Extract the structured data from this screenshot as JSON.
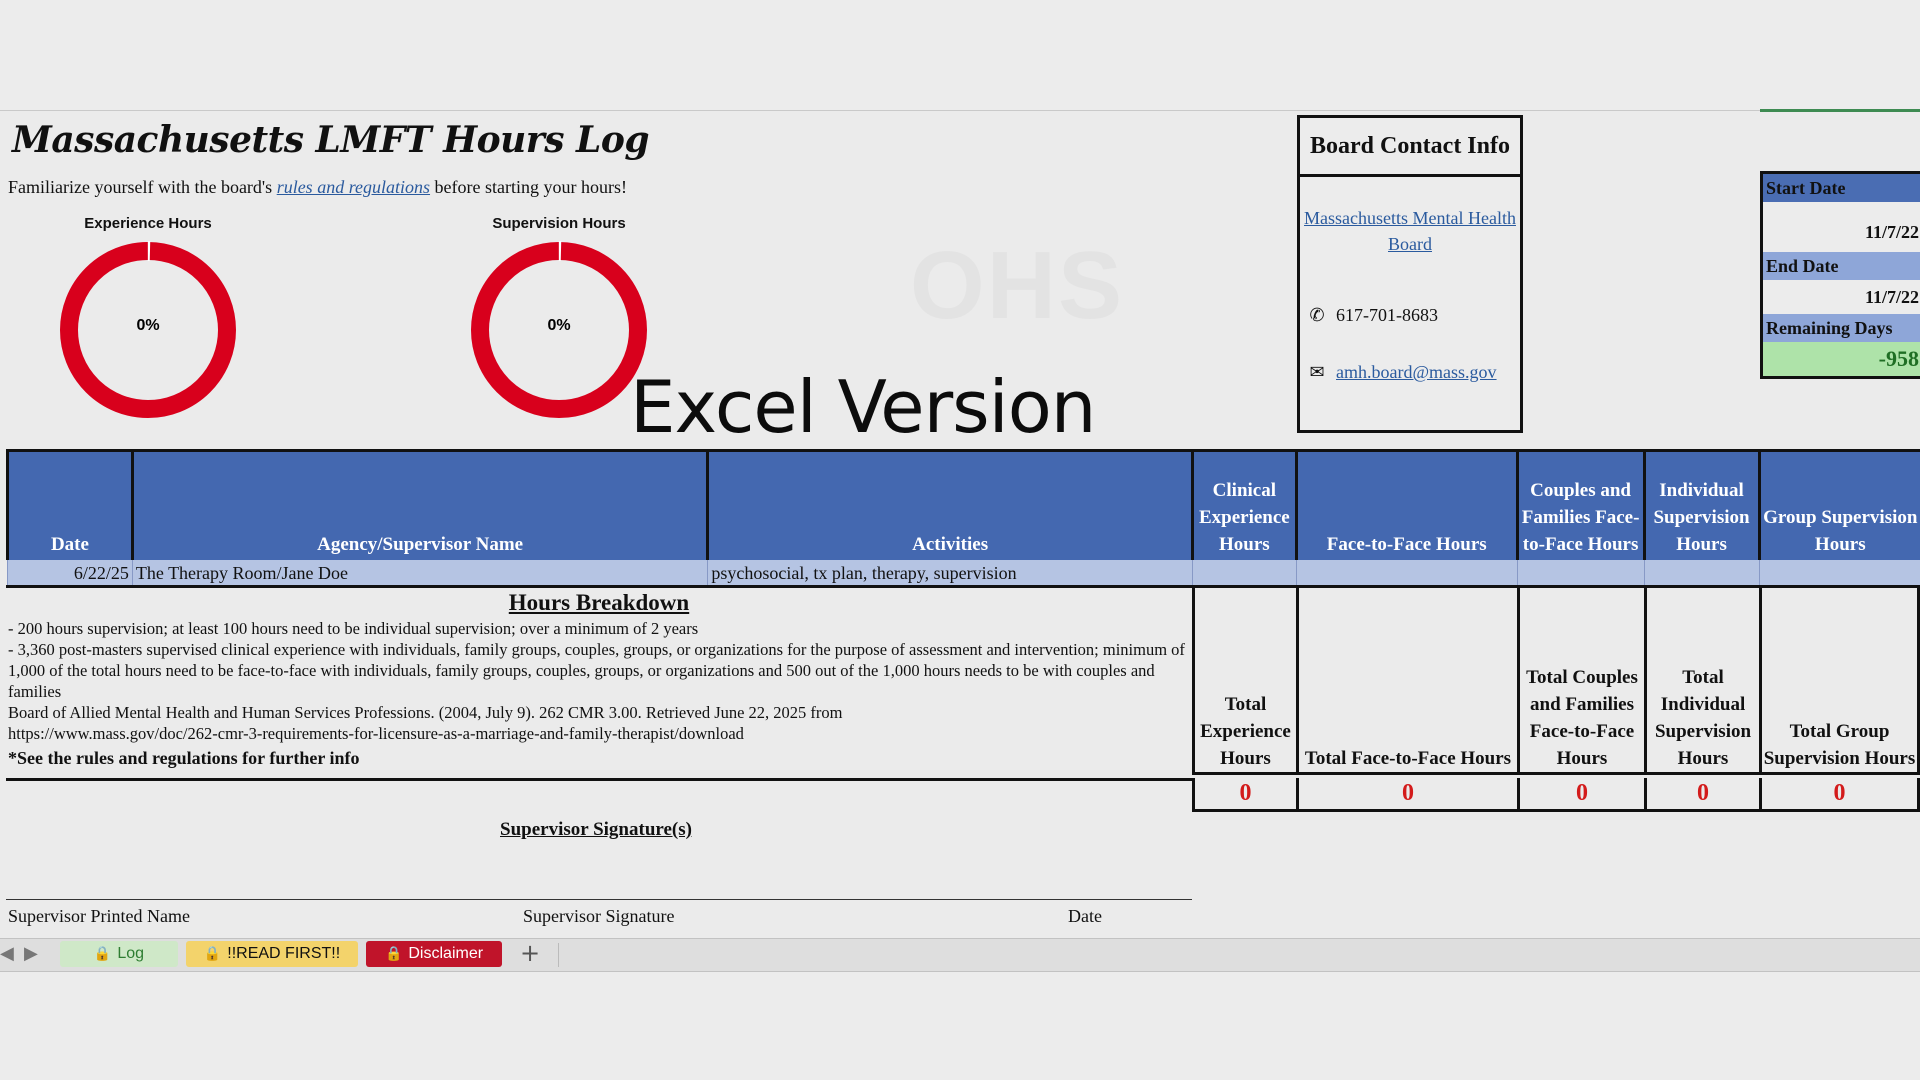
{
  "title": "Massachusetts LMFT Hours Log",
  "intro": {
    "before": "Familiarize yourself with the board's ",
    "link": "rules and regulations",
    "after": " before starting your hours!"
  },
  "gauges": [
    {
      "title": "Experience Hours",
      "percent_label": "0%",
      "value": 0
    },
    {
      "title": "Supervision Hours",
      "percent_label": "0%",
      "value": 0
    }
  ],
  "overlay_text": "Excel Version",
  "watermark": "OHS",
  "contact": {
    "heading": "Board Contact Info",
    "board_link": "Massachusetts Mental Health Board",
    "phone": "617-701-8683",
    "email": "amh.board@mass.gov"
  },
  "dates": {
    "start_label": "Start Date",
    "start_value": "11/7/22",
    "end_label": "End Date",
    "end_value": "11/7/22",
    "remaining_label": "Remaining Days",
    "remaining_value": "-958"
  },
  "table": {
    "headers": [
      "Date",
      "Agency/Supervisor Name",
      "Activities",
      "Clinical Experience Hours",
      "Face-to-Face Hours",
      "Couples and Families Face-to-Face Hours",
      "Individual Supervision Hours",
      "Group Supervision Hours"
    ],
    "rows": [
      [
        "6/22/25",
        "The Therapy Room/Jane Doe",
        "psychosocial, tx plan, therapy, supervision",
        "",
        "",
        "",
        "",
        ""
      ]
    ]
  },
  "breakdown": {
    "heading": "Hours Breakdown",
    "lines": [
      "- 200 hours supervision; at least 100 hours need to be individual supervision; over a minimum of 2 years",
      "- 3,360 post-masters supervised clinical experience with individuals, family groups, couples, groups, or organizations for the purpose of assessment and intervention; minimum of 1,000 of the total hours need to be face-to-face with individuals, family groups, couples, groups, or organizations and 500 out of the 1,000 hours needs to be with couples and families",
      "Board of Allied Mental Health and Human Services Professions. (2004, July 9). 262 CMR 3.00. Retrieved June 22, 2025 from",
      "https://www.mass.gov/doc/262-cmr-3-requirements-for-licensure-as-a-marriage-and-family-therapist/download"
    ],
    "note": "*See the rules and regulations for further info"
  },
  "totals": [
    {
      "label": "Total Experience Hours",
      "value": "0"
    },
    {
      "label": "Total Face-to-Face Hours",
      "value": "0"
    },
    {
      "label": "Total Couples and Families Face-to-Face Hours",
      "value": "0"
    },
    {
      "label": "Total Individual Supervision Hours",
      "value": "0"
    },
    {
      "label": "Total Group Supervision Hours",
      "value": "0"
    }
  ],
  "signature": {
    "heading": "Supervisor Signature(s)",
    "printed_name": "Supervisor Printed Name",
    "signature": "Supervisor Signature",
    "date": "Date"
  },
  "tabs": [
    {
      "label": "Log",
      "color": "#cfe8c8",
      "text_color": "#2e7d32"
    },
    {
      "label": "!!READ FIRST!!",
      "color": "#f3d36b",
      "text_color": "#111111"
    },
    {
      "label": "Disclaimer",
      "color": "#c0142a",
      "text_color": "#ffffff"
    }
  ],
  "colors": {
    "header_blue": "#4468b0",
    "row_blue": "#b5c4e3",
    "gauge_red": "#d8001c",
    "total_red": "#d31b1b"
  }
}
